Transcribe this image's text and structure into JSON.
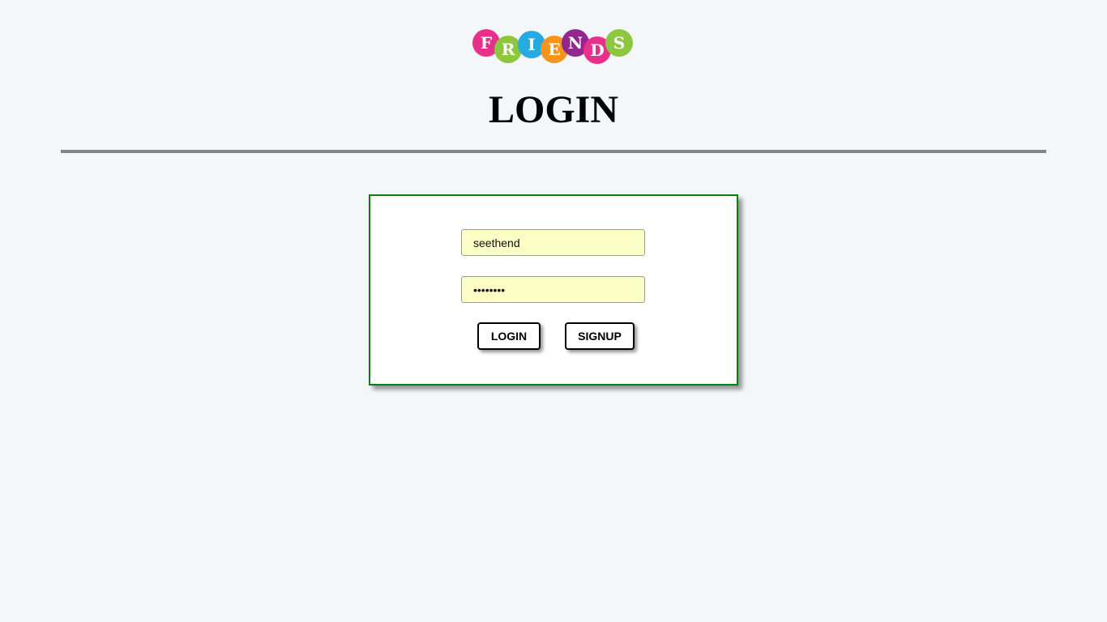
{
  "logo": {
    "letters": [
      {
        "char": "F",
        "color": "#e8308a"
      },
      {
        "char": "R",
        "color": "#8dc63f"
      },
      {
        "char": "I",
        "color": "#27aae1"
      },
      {
        "char": "E",
        "color": "#f7941d"
      },
      {
        "char": "N",
        "color": "#92278f"
      },
      {
        "char": "D",
        "color": "#e8308a"
      },
      {
        "char": "S",
        "color": "#8dc63f"
      }
    ]
  },
  "header": {
    "title": "LOGIN"
  },
  "form": {
    "username_value": "seethend",
    "password_value": "12345678",
    "login_label": "LOGIN",
    "signup_label": "SIGNUP"
  },
  "colors": {
    "page_background": "#f4f7fa",
    "box_border": "#0a7c14",
    "input_background": "#fbfec5",
    "divider": "#858585"
  }
}
